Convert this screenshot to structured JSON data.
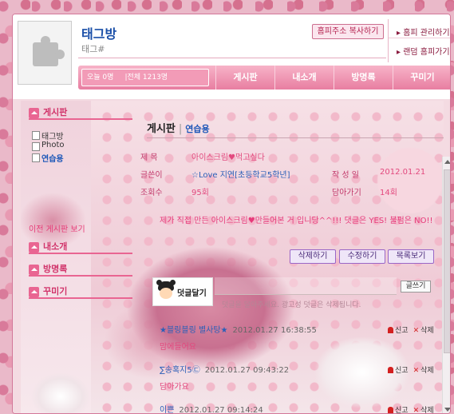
{
  "header": {
    "title": "태그방",
    "subtitle": "태그#",
    "copy_button": "홈피주소 복사하기",
    "side_links": [
      "홈피 관리하기",
      "랜덤 홈피가기"
    ]
  },
  "visit_counter": {
    "today": "오늘 0명",
    "total": "|전체 1213명"
  },
  "nav_tabs": [
    "게시판",
    "내소개",
    "방명록",
    "꾸미기"
  ],
  "sidebar": {
    "board_heading": "게시판",
    "board_items": [
      "태그방",
      "Photo",
      "연습용"
    ],
    "prev_item": "이전 게시판 보기",
    "intro_heading": "내소개",
    "guestbook_heading": "방명록",
    "decorate_heading": "꾸미기"
  },
  "board": {
    "heading": "게시판",
    "category": "연습용",
    "title_label": "제 목",
    "title_value": "아이스크림♥먹고싶다",
    "author_label": "글쓴이",
    "author_value": "☆Love 지연[초등학교5학년]",
    "date_label": "작 성 일",
    "date_value": "2012.01.21",
    "views_label": "조회수",
    "views_value": "95회",
    "replies_label": "담아가기",
    "replies_value": "14회",
    "content": "제가 직접 만든 아이스크림♥만들어본 거 입니당^^!!! 댓글은 YES! 불펌은 NO!!"
  },
  "actions": {
    "delete": "삭제하기",
    "edit": "수정하기",
    "list": "목록보기"
  },
  "comment_box": {
    "avatar_label": "덧글달기",
    "hint": "덧글을 달아주세요. 광고성 덧글은 삭제됩니다.",
    "write_button": "글쓰기"
  },
  "comments": [
    {
      "nick": "★블링블링 별사탕★",
      "date": "2012.01.27 16:38:55",
      "text": "맘에들어요"
    },
    {
      "nick": "∑송혹지5㉢",
      "date": "2012.01.27 09:43:22",
      "text": "담아가요"
    },
    {
      "nick": "이쁜",
      "date": "2012.01.27 09:14:24",
      "text": ""
    }
  ],
  "comment_actions": {
    "report": "신고",
    "delete": "삭제"
  }
}
